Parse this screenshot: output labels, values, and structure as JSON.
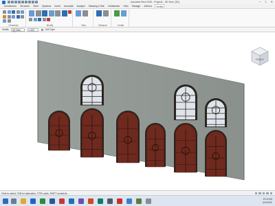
{
  "titlebar": {
    "title": "Autodesk Revit 2020 - Project1 - 3D View: {3D}",
    "window_controls": [
      "─",
      "□",
      "✕"
    ]
  },
  "ribbon_tabs": [
    {
      "label": "Architecture",
      "active": false
    },
    {
      "label": "Structure",
      "active": false
    },
    {
      "label": "Steel",
      "active": false
    },
    {
      "label": "Systems",
      "active": false
    },
    {
      "label": "Insert",
      "active": false
    },
    {
      "label": "Annotate",
      "active": false
    },
    {
      "label": "Analyze",
      "active": false
    },
    {
      "label": "Massing & Site",
      "active": false
    },
    {
      "label": "Collaborate",
      "active": false
    },
    {
      "label": "View",
      "active": false
    },
    {
      "label": "Manage",
      "active": false
    },
    {
      "label": "Add-Ins",
      "active": false
    },
    {
      "label": "Modify",
      "active": true
    }
  ],
  "ribbon_groups": [
    {
      "label": "Geometry",
      "icon_count": 12
    },
    {
      "label": "Modify",
      "icon_count": 18
    },
    {
      "label": "View",
      "icon_count": 4
    },
    {
      "label": "Measure",
      "icon_count": 3
    },
    {
      "label": "Create",
      "icon_count": 3
    }
  ],
  "options_bar": {
    "modify_label": "Modify",
    "view_field": "3D View: {3D}",
    "scale_value": "1:100",
    "edit_type_label": "Edit Type"
  },
  "status_bar": {
    "text": "Click to select, TAB for alternates, CTRL adds, SHIFT unselects."
  },
  "viewcube": {
    "label": "FRONT"
  },
  "taskbar": {
    "time": "10:42 AM",
    "date": "3/14/2020"
  },
  "colors": {
    "wall": "#939a96",
    "door_wood": "#6e2a1e",
    "frame": "#2a2522",
    "glass": "#dfe4ea"
  }
}
